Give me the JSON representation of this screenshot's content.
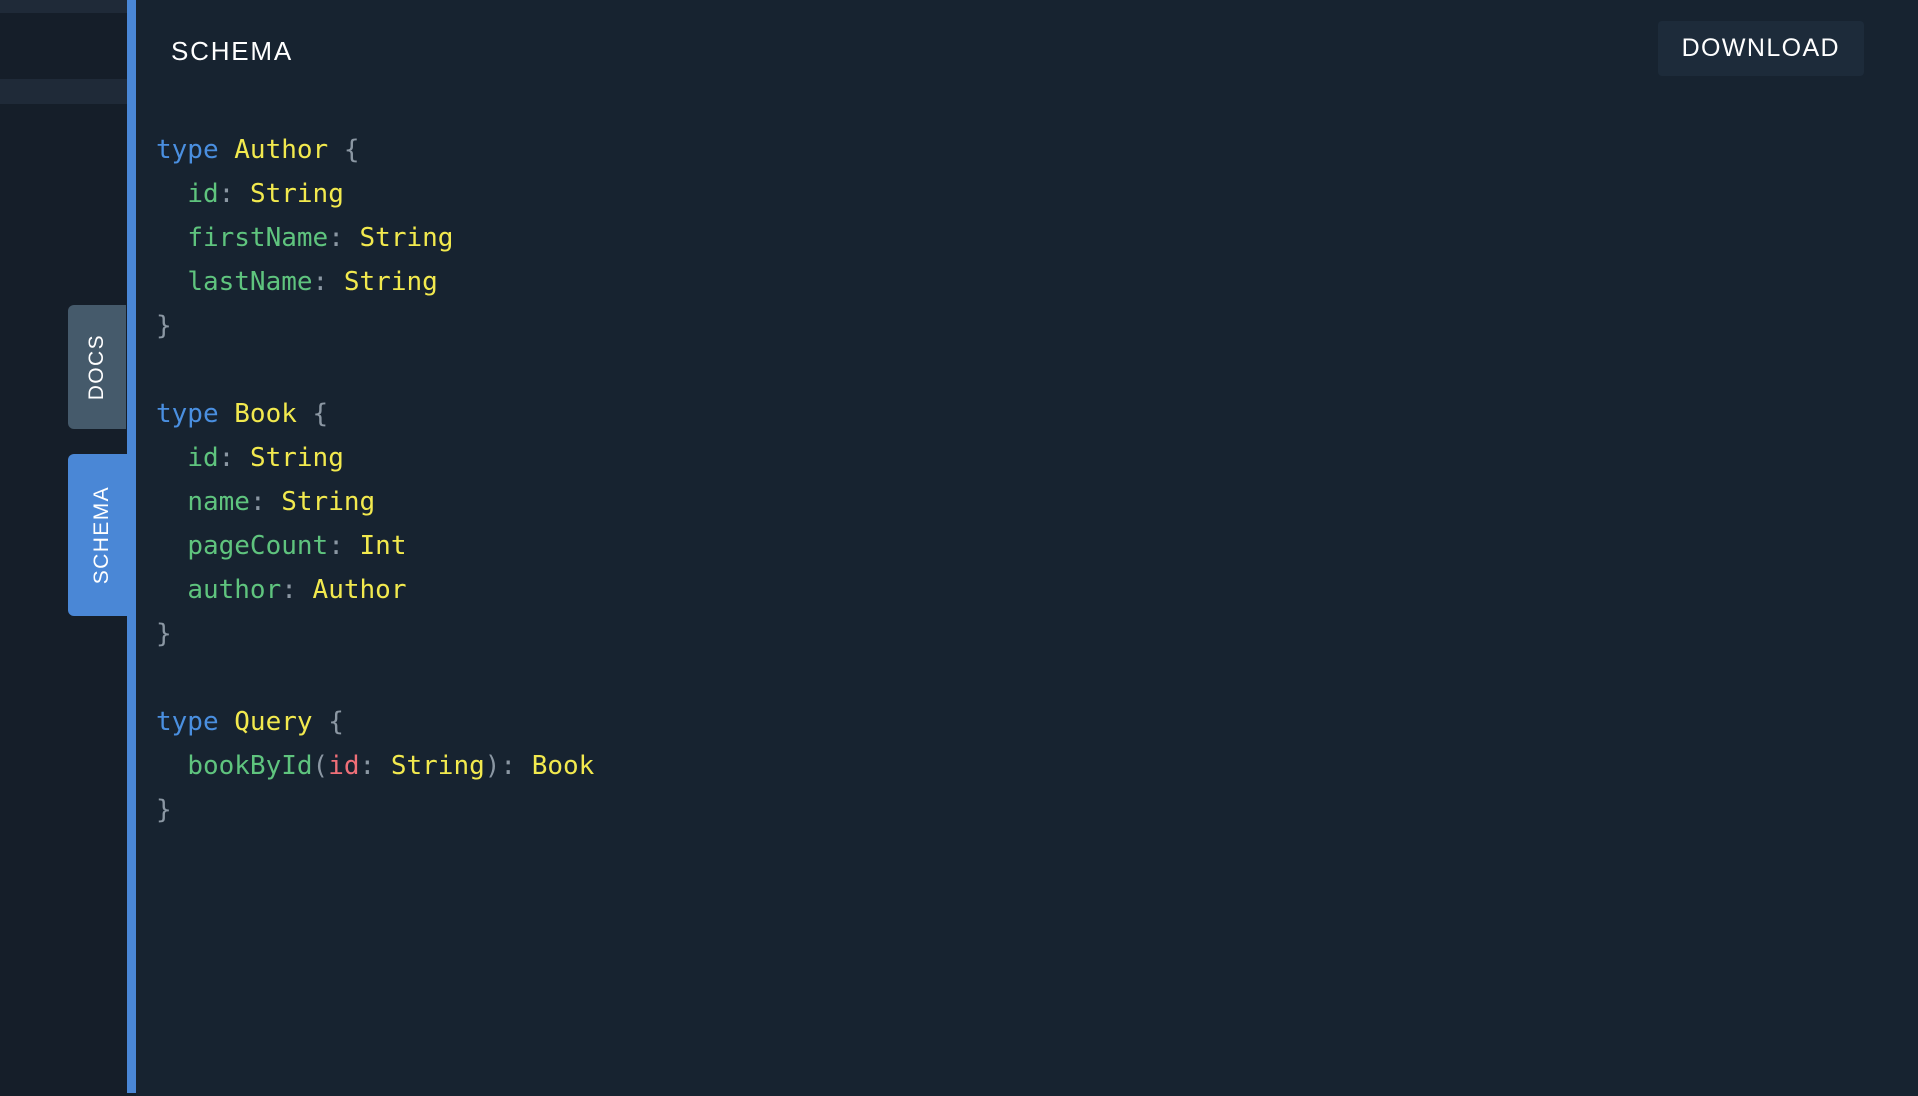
{
  "app": {
    "background_color": "#0f1823",
    "panel_color": "#172330",
    "accent_color": "#4a87d6"
  },
  "left_gutter": {
    "label": "editor-gutter"
  },
  "side_tabs": [
    {
      "id": "docs",
      "label": "DOCS",
      "active": false,
      "color": "#455a6b"
    },
    {
      "id": "schema",
      "label": "SCHEMA",
      "active": true,
      "color": "#4a87d6"
    }
  ],
  "header": {
    "title": "SCHEMA",
    "download_label": "DOWNLOAD"
  },
  "schema": {
    "lines": [
      {
        "tokens": [
          {
            "t": "type",
            "c": "keyword"
          },
          {
            "t": " ",
            "c": "punct"
          },
          {
            "t": "Author",
            "c": "typename"
          },
          {
            "t": " {",
            "c": "punct"
          }
        ]
      },
      {
        "tokens": [
          {
            "t": "  ",
            "c": "punct"
          },
          {
            "t": "id",
            "c": "field"
          },
          {
            "t": ": ",
            "c": "punct"
          },
          {
            "t": "String",
            "c": "typename"
          }
        ]
      },
      {
        "tokens": [
          {
            "t": "  ",
            "c": "punct"
          },
          {
            "t": "firstName",
            "c": "field"
          },
          {
            "t": ": ",
            "c": "punct"
          },
          {
            "t": "String",
            "c": "typename"
          }
        ]
      },
      {
        "tokens": [
          {
            "t": "  ",
            "c": "punct"
          },
          {
            "t": "lastName",
            "c": "field"
          },
          {
            "t": ": ",
            "c": "punct"
          },
          {
            "t": "String",
            "c": "typename"
          }
        ]
      },
      {
        "tokens": [
          {
            "t": "}",
            "c": "punct"
          }
        ]
      },
      {
        "tokens": []
      },
      {
        "tokens": [
          {
            "t": "type",
            "c": "keyword"
          },
          {
            "t": " ",
            "c": "punct"
          },
          {
            "t": "Book",
            "c": "typename"
          },
          {
            "t": " {",
            "c": "punct"
          }
        ]
      },
      {
        "tokens": [
          {
            "t": "  ",
            "c": "punct"
          },
          {
            "t": "id",
            "c": "field"
          },
          {
            "t": ": ",
            "c": "punct"
          },
          {
            "t": "String",
            "c": "typename"
          }
        ]
      },
      {
        "tokens": [
          {
            "t": "  ",
            "c": "punct"
          },
          {
            "t": "name",
            "c": "field"
          },
          {
            "t": ": ",
            "c": "punct"
          },
          {
            "t": "String",
            "c": "typename"
          }
        ]
      },
      {
        "tokens": [
          {
            "t": "  ",
            "c": "punct"
          },
          {
            "t": "pageCount",
            "c": "field"
          },
          {
            "t": ": ",
            "c": "punct"
          },
          {
            "t": "Int",
            "c": "typename"
          }
        ]
      },
      {
        "tokens": [
          {
            "t": "  ",
            "c": "punct"
          },
          {
            "t": "author",
            "c": "field"
          },
          {
            "t": ": ",
            "c": "punct"
          },
          {
            "t": "Author",
            "c": "typename"
          }
        ]
      },
      {
        "tokens": [
          {
            "t": "}",
            "c": "punct"
          }
        ]
      },
      {
        "tokens": []
      },
      {
        "tokens": [
          {
            "t": "type",
            "c": "keyword"
          },
          {
            "t": " ",
            "c": "punct"
          },
          {
            "t": "Query",
            "c": "typename"
          },
          {
            "t": " {",
            "c": "punct"
          }
        ]
      },
      {
        "tokens": [
          {
            "t": "  ",
            "c": "punct"
          },
          {
            "t": "bookById",
            "c": "field"
          },
          {
            "t": "(",
            "c": "punct"
          },
          {
            "t": "id",
            "c": "arg"
          },
          {
            "t": ": ",
            "c": "punct"
          },
          {
            "t": "String",
            "c": "typename"
          },
          {
            "t": "): ",
            "c": "punct"
          },
          {
            "t": "Book",
            "c": "typename"
          }
        ]
      },
      {
        "tokens": [
          {
            "t": "}",
            "c": "punct"
          }
        ]
      }
    ],
    "colors": {
      "keyword": "#4a8fe0",
      "typename": "#f2e94e",
      "field": "#5fc47e",
      "punct": "#8b97a3",
      "arg": "#ef6f78"
    }
  }
}
